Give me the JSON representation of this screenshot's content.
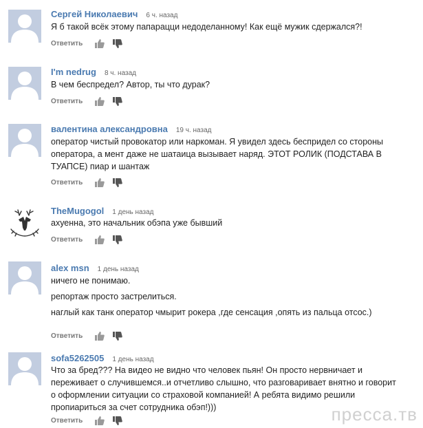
{
  "comments": [
    {
      "author": "Сергей Николаевич",
      "time": "6 ч. назад",
      "lines": [
        "Я б такой всёк этому папарацци недоделанному! Как ещё мужик сдержался?!"
      ],
      "reply": "Ответить",
      "avatar": "default"
    },
    {
      "author": "I'm nedrug",
      "time": "8 ч. назад",
      "lines": [
        "В чем беспредел? Автор, ты что дурак?"
      ],
      "reply": "Ответить",
      "avatar": "default"
    },
    {
      "author": "валентина александровна",
      "time": "19 ч. назад",
      "lines": [
        "оператор чистый провокатор или наркоман. Я увидел здесь беспридел со стороны",
        "оператора, а мент даже не шатаица вызывает наряд. ЭТОТ РОЛИК (ПОДСТАВА В",
        "ТУАПСЕ) пиар и шантаж"
      ],
      "reply": "Ответить",
      "avatar": "default"
    },
    {
      "author": "TheMugogol",
      "time": "1 день назад",
      "lines": [
        "ахуенна, это начальник обэпа уже бывший"
      ],
      "reply": "Ответить",
      "avatar": "deer"
    },
    {
      "author": "alex msn",
      "time": "1 день назад",
      "lines": [
        "ничего не понимаю.",
        "репортаж просто застрелиться.",
        "наглый как танк оператор чмырит рокера ,где сенсация ,опять из пальца отсос.)"
      ],
      "reply": "Ответить",
      "avatar": "default"
    },
    {
      "author": "sofa5262505",
      "time": "1 день назад",
      "lines": [
        "Что за бред??? На видео не видно что человек пьян! Он просто нервничает и",
        "переживает о случившемся..и отчетливо слышно, что разговаривает внятно и говорит",
        "о оформлении ситуации со страховой компанией! А ребята видимо решили",
        "пропиариться за счет сотрудника обэп!)))"
      ],
      "reply": "Ответить",
      "avatar": "default"
    }
  ],
  "watermark": "пресса.тв",
  "icons": [
    "thumbs-up-icon",
    "thumbs-down-icon",
    "default-avatar-icon",
    "deer-avatar-icon"
  ],
  "colors": {
    "author": "#4a7ab0",
    "avatar_bg": "#c2cde0",
    "meta": "#666666"
  }
}
